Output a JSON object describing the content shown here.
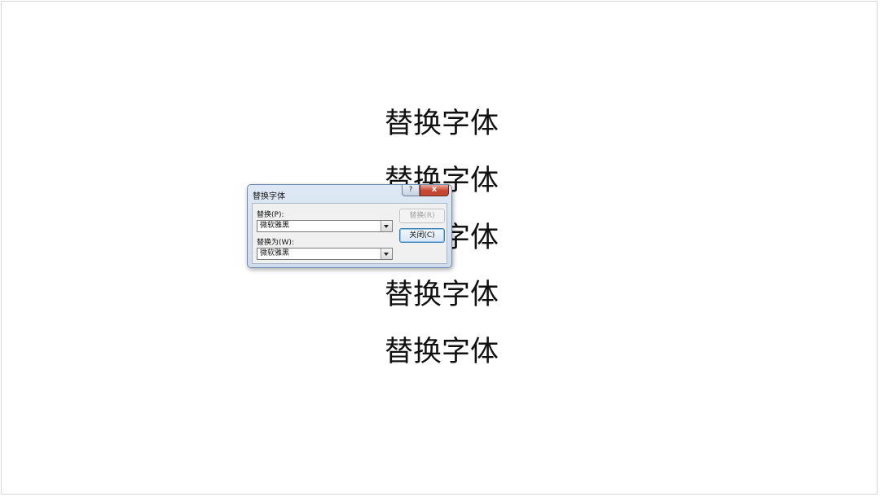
{
  "slide": {
    "lines": [
      "替换字体",
      "替换字体",
      "替换字体",
      "替换字体",
      "替换字体"
    ]
  },
  "dialog": {
    "title": "替换字体",
    "help_icon": "?",
    "close_icon": "x",
    "replace_label": "替换(P):",
    "replace_value": "微软雅黑",
    "with_label": "替换为(W):",
    "with_value": "微软雅黑",
    "replace_button": "替换(R)",
    "close_button": "关闭(C)"
  }
}
